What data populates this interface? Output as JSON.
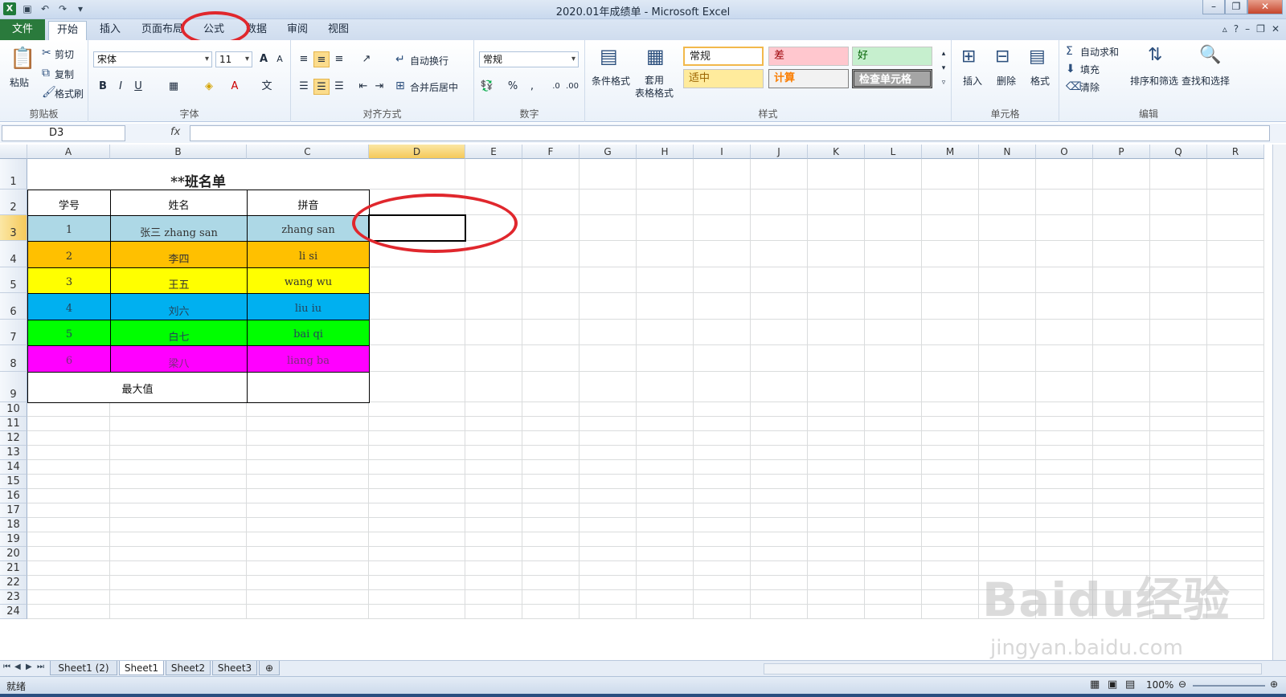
{
  "window": {
    "title": "2020.01年成绩单 - Microsoft Excel",
    "logo": "X"
  },
  "ribbon_tabs": {
    "file": "文件",
    "home": "开始",
    "insert": "插入",
    "layout": "页面布局",
    "formulas": "公式",
    "data": "数据",
    "review": "审阅",
    "view": "视图"
  },
  "clipboard": {
    "paste": "粘贴",
    "cut": "剪切",
    "copy": "复制",
    "format_painter": "格式刷",
    "label": "剪贴板"
  },
  "font": {
    "name": "宋体",
    "size": "11",
    "label": "字体"
  },
  "alignment": {
    "wrap": "自动换行",
    "merge": "合并后居中",
    "label": "对齐方式"
  },
  "number": {
    "format": "常规",
    "label": "数字"
  },
  "styles": {
    "conditional": "条件格式",
    "table_format": "套用\n表格格式",
    "normal": "常规",
    "bad": "差",
    "good": "好",
    "neutral": "适中",
    "calc": "计算",
    "check": "检查单元格",
    "label": "样式"
  },
  "cells": {
    "insert": "插入",
    "delete": "删除",
    "format": "格式",
    "label": "单元格"
  },
  "editing": {
    "autosum": "自动求和",
    "fill": "填充",
    "clear": "清除",
    "sort": "排序和筛选",
    "find": "查找和选择",
    "label": "编辑"
  },
  "formula_bar": {
    "name_box": "D3",
    "fx": "fx",
    "value": ""
  },
  "columns": [
    "A",
    "B",
    "C",
    "D",
    "E",
    "F",
    "G",
    "H",
    "I",
    "J",
    "K",
    "L",
    "M",
    "N",
    "O",
    "P",
    "Q",
    "R"
  ],
  "rows": [
    "1",
    "2",
    "3",
    "4",
    "5",
    "6",
    "7",
    "8",
    "9",
    "10",
    "11",
    "12",
    "13",
    "14",
    "15",
    "16",
    "17",
    "18",
    "19",
    "20",
    "21",
    "22",
    "23",
    "24"
  ],
  "sheet": {
    "title": "**班名单",
    "headers": [
      "学号",
      "姓名",
      "拼音"
    ],
    "records": [
      {
        "id": "1",
        "name": "张三 zhang san",
        "pinyin": "zhang san",
        "color": "#add8e6"
      },
      {
        "id": "2",
        "name": "李四",
        "pinyin": "li si",
        "color": "#ffc000"
      },
      {
        "id": "3",
        "name": "王五",
        "pinyin": "wang wu",
        "color": "#ffff00"
      },
      {
        "id": "4",
        "name": "刘六",
        "pinyin": "liu iu",
        "color": "#00b0f0"
      },
      {
        "id": "5",
        "name": "白七",
        "pinyin": "bai qi",
        "color": "#00ff00"
      },
      {
        "id": "6",
        "name": "梁八",
        "pinyin": "liang ba",
        "color": "#ff00ff"
      }
    ],
    "max_label": "最大值",
    "selected_cell": "D3"
  },
  "sheet_tabs": [
    "Sheet1 (2)",
    "Sheet1",
    "Sheet2",
    "Sheet3"
  ],
  "status": {
    "ready": "就绪",
    "zoom": "100%"
  },
  "watermark": {
    "brand": "Baidu经验",
    "url": "jingyan.baidu.com"
  },
  "colors": {
    "annotation": "#e0272d",
    "file_tab": "#2a7a3c",
    "selection_header": "#f5c95a"
  }
}
